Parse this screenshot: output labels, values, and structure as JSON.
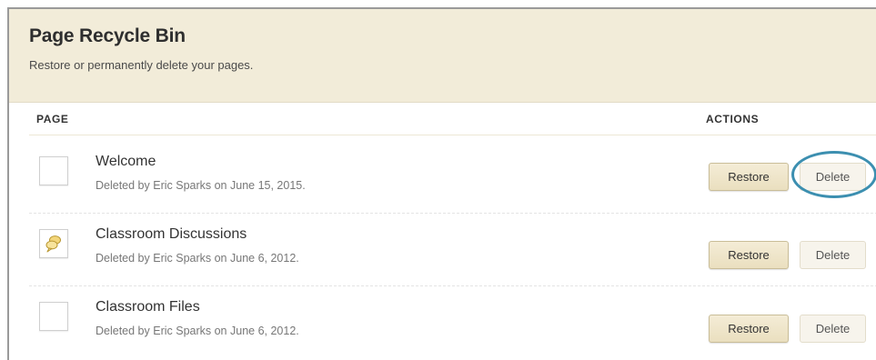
{
  "header": {
    "title": "Page Recycle Bin",
    "subtitle": "Restore or permanently delete your pages."
  },
  "columns": {
    "page": "PAGE",
    "actions": "ACTIONS"
  },
  "rows": [
    {
      "title": "Welcome",
      "meta": "Deleted by Eric Sparks on June 15, 2015.",
      "icon": "blank-page-icon",
      "restore_label": "Restore",
      "delete_label": "Delete",
      "delete_highlighted": true
    },
    {
      "title": "Classroom Discussions",
      "meta": "Deleted by Eric Sparks on June 6, 2012.",
      "icon": "discussion-bubbles-icon",
      "restore_label": "Restore",
      "delete_label": "Delete",
      "delete_highlighted": false
    },
    {
      "title": "Classroom Files",
      "meta": "Deleted by Eric Sparks on June 6, 2012.",
      "icon": "blank-page-icon",
      "restore_label": "Restore",
      "delete_label": "Delete",
      "delete_highlighted": false
    }
  ],
  "colors": {
    "header_bg": "#f2ecd9",
    "restore_button": "#eee4c8",
    "highlight_ring": "#3c8fb0"
  }
}
